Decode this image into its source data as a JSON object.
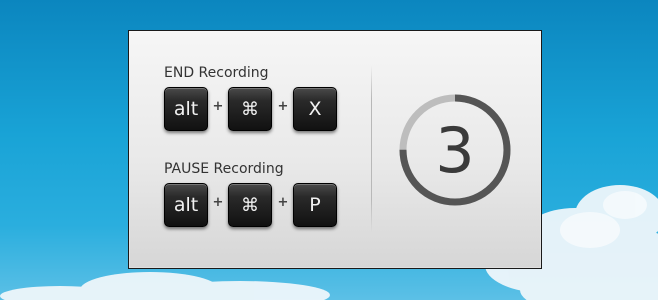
{
  "dialog": {
    "end": {
      "label": "END Recording",
      "keys": [
        "alt",
        "⌘",
        "X"
      ]
    },
    "pause": {
      "label": "PAUSE Recording",
      "keys": [
        "alt",
        "⌘",
        "P"
      ]
    },
    "separator": "+",
    "countdown": {
      "value": "3",
      "progress_fraction": 0.75
    }
  },
  "colors": {
    "sky": "#19a3d6",
    "ring_track": "#bdbdbd",
    "ring_progress": "#555555",
    "key_face": "#222222"
  },
  "icons": [
    "command-key-icon"
  ]
}
